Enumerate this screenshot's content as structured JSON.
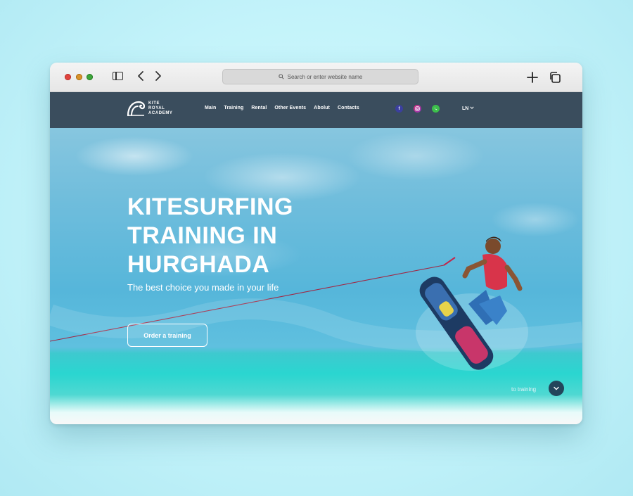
{
  "browser": {
    "address_placeholder": "Search or enter website name"
  },
  "site": {
    "logo_lines": [
      "KITE",
      "ROYAL",
      "ACADEMY"
    ],
    "menu": [
      "Main",
      "Training",
      "Rental",
      "Other Events",
      "Abolut",
      "Contacts"
    ],
    "social_icons": [
      "facebook-icon",
      "instagram-icon",
      "whatsapp-icon"
    ],
    "language": "LN"
  },
  "hero": {
    "title_lines": [
      "KITESURFING",
      "TRAINING IN",
      "HURGHADA"
    ],
    "subtitle": "The best choice you made in your life",
    "cta_label": "Order a training",
    "scroll_hint": "to training"
  },
  "colors": {
    "header_bg": "#3a4d5d",
    "scroll_button": "#23465b",
    "page_bg": "#c3f3fa"
  }
}
